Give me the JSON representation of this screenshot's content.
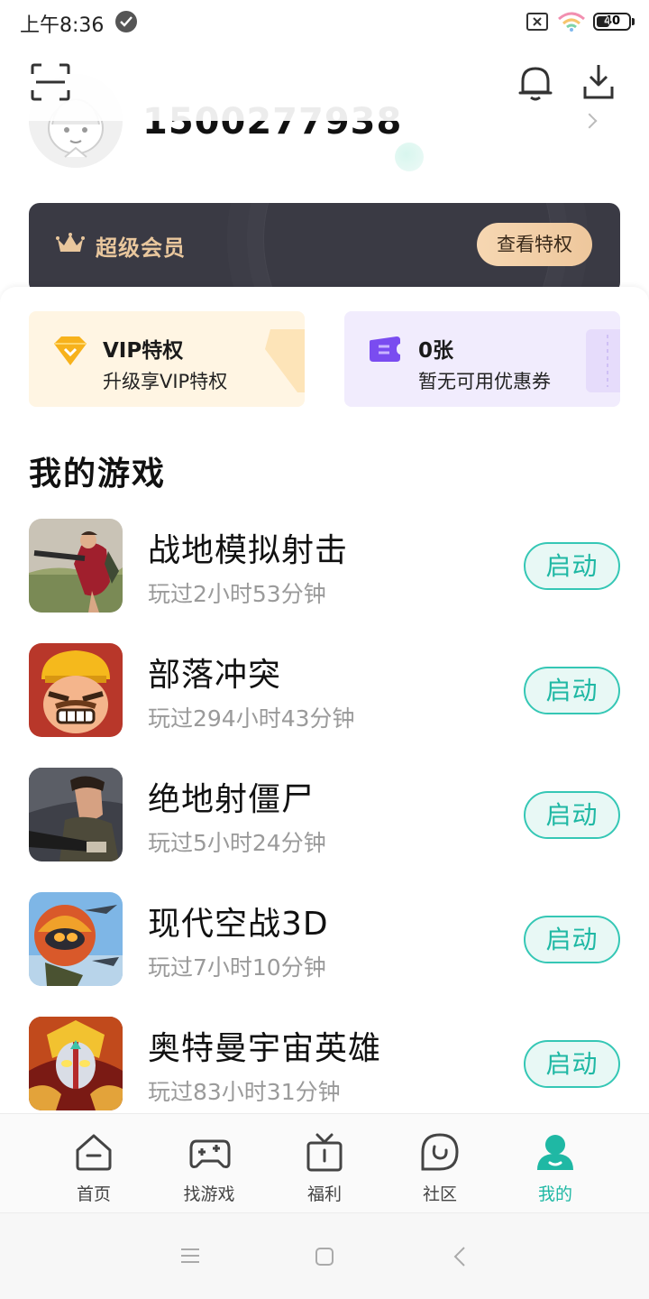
{
  "status_bar": {
    "time": "上午8:36",
    "battery": "40",
    "battery_level": 0.4
  },
  "header": {
    "scan_icon": "scan-icon",
    "bell_icon": "bell-icon",
    "download_icon": "download-icon",
    "username": "1500277938"
  },
  "vip_banner": {
    "title": "超级会员",
    "button_label": "查看特权",
    "accent_color": "#e9c79d"
  },
  "cards": {
    "vip": {
      "title": "VIP特权",
      "subtitle": "升级享VIP特权"
    },
    "coupon": {
      "title": "0张",
      "subtitle": "暂无可用优惠券"
    }
  },
  "my_games": {
    "title": "我的游戏",
    "launch_label": "启动",
    "games": [
      {
        "name": "战地模拟射击",
        "played": "玩过2小时53分钟"
      },
      {
        "name": "部落冲突",
        "played": "玩过294小时43分钟"
      },
      {
        "name": "绝地射僵尸",
        "played": "玩过5小时24分钟"
      },
      {
        "name": "现代空战3D",
        "played": "玩过7小时10分钟"
      },
      {
        "name": "奥特曼宇宙英雄",
        "played": "玩过83小时31分钟"
      }
    ]
  },
  "bottom_nav": {
    "active_color": "#1fb8a4",
    "items": [
      {
        "label": "首页",
        "icon": "home-icon"
      },
      {
        "label": "找游戏",
        "icon": "gamepad-icon"
      },
      {
        "label": "福利",
        "icon": "gift-icon"
      },
      {
        "label": "社区",
        "icon": "community-icon"
      },
      {
        "label": "我的",
        "icon": "profile-icon"
      }
    ]
  }
}
